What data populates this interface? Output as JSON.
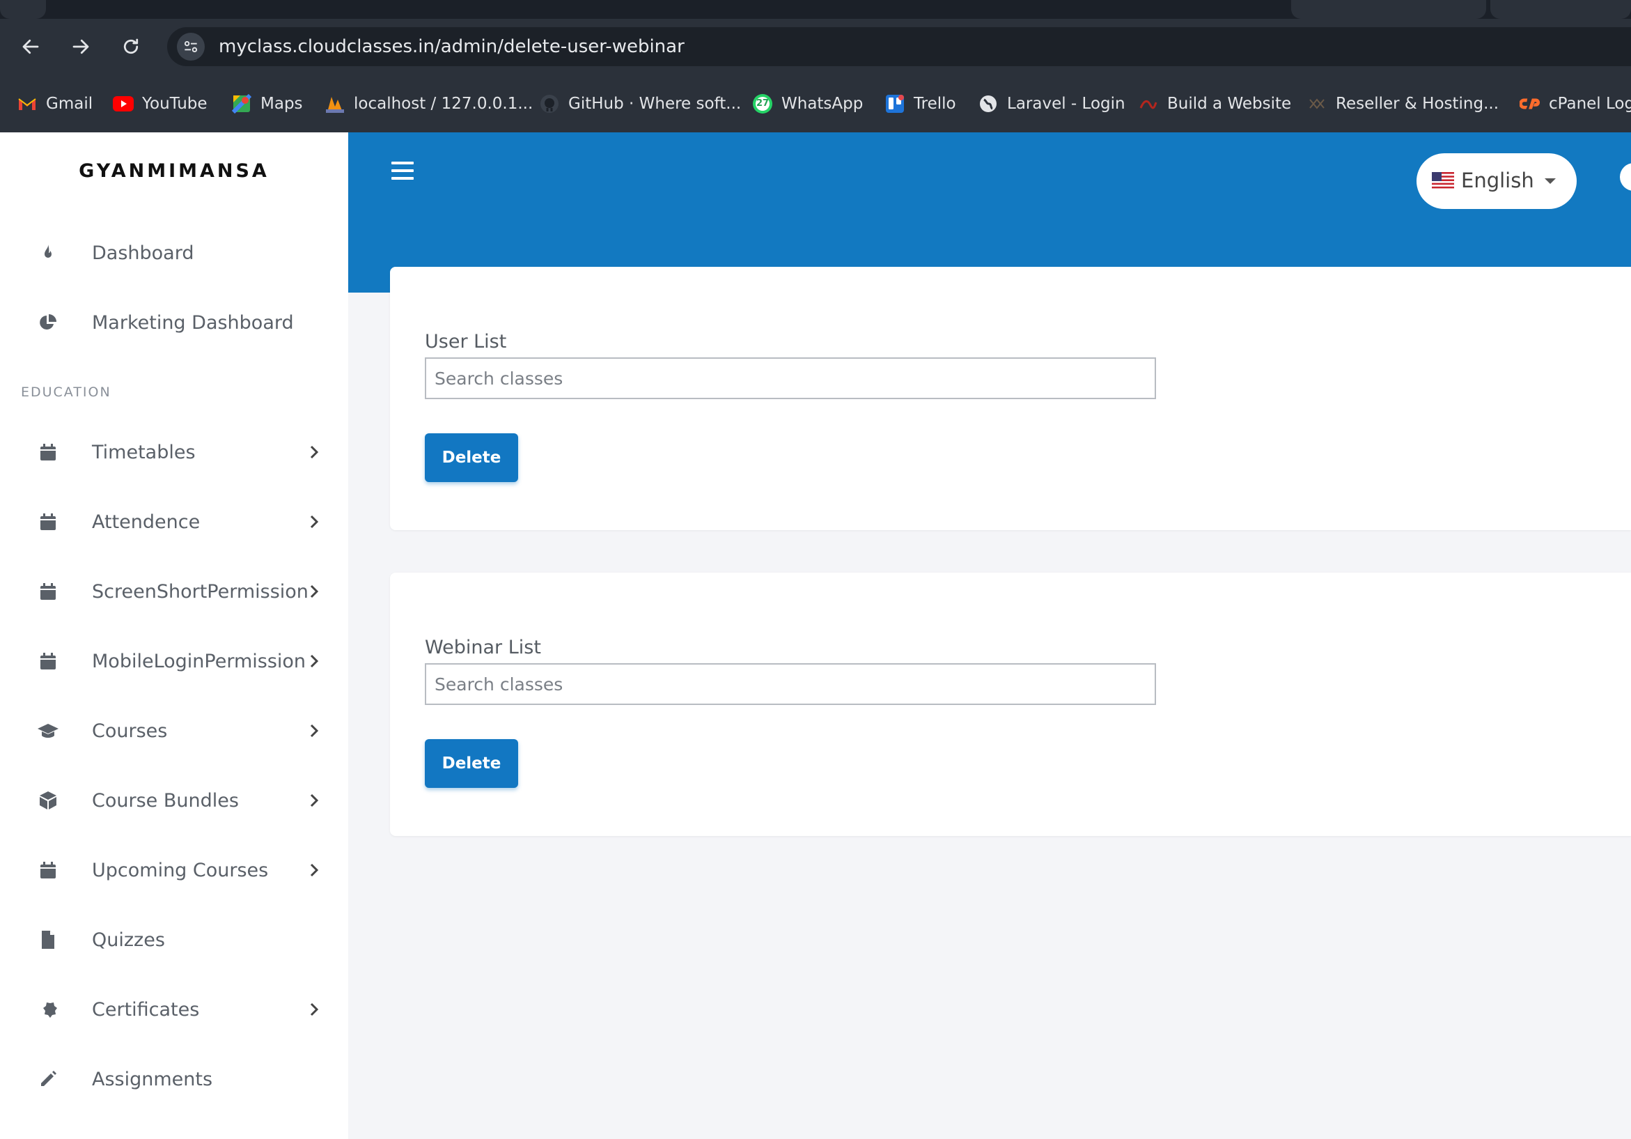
{
  "browser": {
    "url": "myclass.cloudclasses.in/admin/delete-user-webinar",
    "bookmarks": [
      {
        "label": "Gmail",
        "icon": "gmail-icon"
      },
      {
        "label": "YouTube",
        "icon": "youtube-icon"
      },
      {
        "label": "Maps",
        "icon": "maps-icon"
      },
      {
        "label": "localhost / 127.0.0.1...",
        "icon": "phpmyadmin-icon"
      },
      {
        "label": "GitHub · Where soft...",
        "icon": "github-icon"
      },
      {
        "label": "WhatsApp",
        "icon": "whatsapp-icon"
      },
      {
        "label": "Trello",
        "icon": "trello-icon"
      },
      {
        "label": "Laravel - Login",
        "icon": "globe-icon"
      },
      {
        "label": "Build a Website",
        "icon": "website-builder-icon"
      },
      {
        "label": "Reseller & Hosting...",
        "icon": "hosting-icon"
      },
      {
        "label": "cPanel Log",
        "icon": "cpanel-icon"
      }
    ],
    "whatsapp_badge": "27"
  },
  "sidebar": {
    "brand": "GYANMIMANSA",
    "top_items": [
      {
        "label": "Dashboard",
        "icon": "fire-icon"
      },
      {
        "label": "Marketing Dashboard",
        "icon": "pie-chart-icon"
      }
    ],
    "section_education": "EDUCATION",
    "items": [
      {
        "label": "Timetables",
        "icon": "calendar-icon",
        "has_submenu": true
      },
      {
        "label": "Attendence",
        "icon": "calendar-icon",
        "has_submenu": true
      },
      {
        "label": "ScreenShortPermission",
        "icon": "calendar-icon",
        "has_submenu": true
      },
      {
        "label": "MobileLoginPermission",
        "icon": "calendar-icon",
        "has_submenu": true
      },
      {
        "label": "Courses",
        "icon": "graduation-cap-icon",
        "has_submenu": true
      },
      {
        "label": "Course Bundles",
        "icon": "box-icon",
        "has_submenu": true
      },
      {
        "label": "Upcoming Courses",
        "icon": "calendar-icon",
        "has_submenu": true
      },
      {
        "label": "Quizzes",
        "icon": "file-icon",
        "has_submenu": false
      },
      {
        "label": "Certificates",
        "icon": "certificate-icon",
        "has_submenu": true
      },
      {
        "label": "Assignments",
        "icon": "pencil-icon",
        "has_submenu": false
      }
    ]
  },
  "header": {
    "language": "English"
  },
  "user_card": {
    "label": "User List",
    "placeholder": "Search classes",
    "button": "Delete"
  },
  "webinar_card": {
    "label": "Webinar List",
    "placeholder": "Search classes",
    "button": "Delete"
  },
  "colors": {
    "primary": "#1279c1",
    "button": "#1277c2",
    "sidebar_bg": "#ffffff",
    "page_bg": "#f4f5f8"
  }
}
